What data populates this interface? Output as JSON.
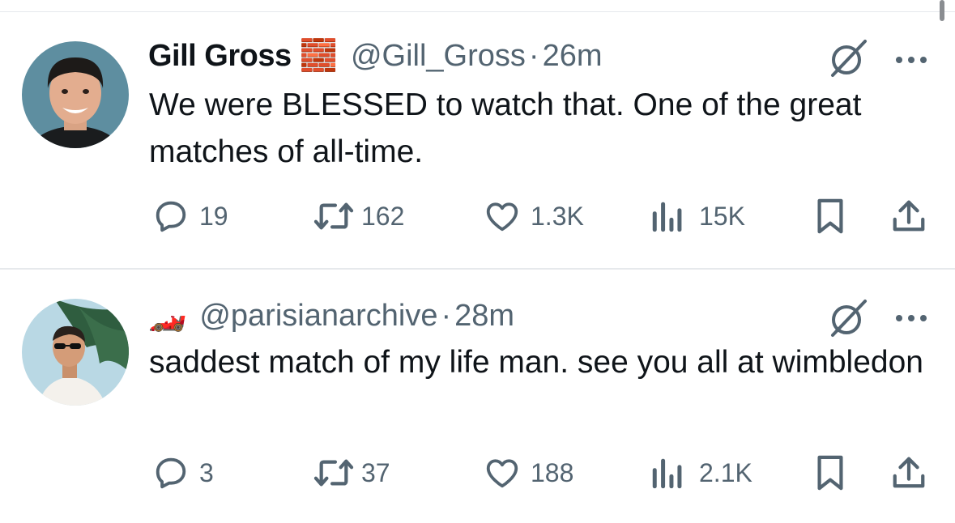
{
  "tweets": [
    {
      "name": "Gill Gross",
      "name_emoji": "🧱",
      "handle": "@Gill_Gross",
      "separator": "·",
      "time": "26m",
      "text": "We were BLESSED to watch that. One of the great matches of all-time.",
      "replies": "19",
      "reposts": "162",
      "likes": "1.3K",
      "views": "15K"
    },
    {
      "name_emoji": "🏎️",
      "handle": "@parisianarchive",
      "separator": "·",
      "time": "28m",
      "text": "saddest match of my life man. see you all at wimbledon",
      "replies": "3",
      "reposts": "37",
      "likes": "188",
      "views": "2.1K"
    }
  ],
  "icons": {
    "reply": "reply-icon",
    "repost": "repost-icon",
    "like": "heart-icon",
    "views": "views-icon",
    "bookmark": "bookmark-icon",
    "share": "share-icon",
    "grok": "grok-icon",
    "more": "more-icon"
  },
  "colors": {
    "icon_gray": "#536471",
    "text": "#0f1419",
    "divider": "#e6e9ec"
  }
}
